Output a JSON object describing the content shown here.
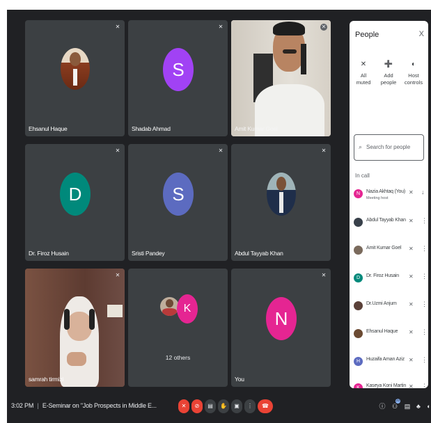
{
  "tiles": [
    {
      "name": "Ehsanul Haque"
    },
    {
      "name": "Shadab Ahmad",
      "initial": "S"
    },
    {
      "name": "Amit Kumar Goel"
    },
    {
      "name": "Dr. Firoz Husain",
      "initial": "D"
    },
    {
      "name": "Sristi Pandey",
      "initial": "S"
    },
    {
      "name": "Abdul Tayyab Khan"
    },
    {
      "name": "samrah tirmizi"
    },
    {
      "name": "12 others",
      "initial": "K"
    },
    {
      "name": "You",
      "initial": "N"
    }
  ],
  "colors": {
    "purple": "#a142f4",
    "teal": "#00897b",
    "indigo": "#5c6bc0",
    "pink": "#e52592",
    "red": "#ea4335",
    "stage": "#202124",
    "tile": "#3c4043"
  },
  "icons": {
    "mic_off": "mic-off-icon",
    "add_person": "add-person-icon",
    "host": "host-controls-icon",
    "search": "search-icon",
    "close": "close-icon",
    "more": "more-vert-icon"
  },
  "people_panel": {
    "title": "People",
    "close": "X",
    "actions": [
      {
        "line1": "All",
        "line2": "muted"
      },
      {
        "line1": "Add",
        "line2": "people"
      },
      {
        "line1": "Host",
        "line2": "controls"
      }
    ],
    "search_placeholder": "Search for people",
    "section": "In call",
    "participants": [
      {
        "name": "Nazia Akhtaq (You)",
        "sub": "Meeting host",
        "initial": "N"
      },
      {
        "name": "Abdul Tayyab Khan"
      },
      {
        "name": "Amit Kumar Goel"
      },
      {
        "name": "Dr. Firoz Husain",
        "initial": "D"
      },
      {
        "name": "Dr.Uzmi Anjum"
      },
      {
        "name": "Ehsanul Haque"
      },
      {
        "name": "Huzaifa Aman Aziz",
        "initial": "H"
      },
      {
        "name": "Kaseya Koni Martin",
        "initial": "K"
      }
    ]
  },
  "bottom_bar": {
    "time": "3:02 PM",
    "divider": "|",
    "meeting_title": "E-Seminar on \"Job Prospects in Middle E...",
    "participant_badge": "20"
  }
}
